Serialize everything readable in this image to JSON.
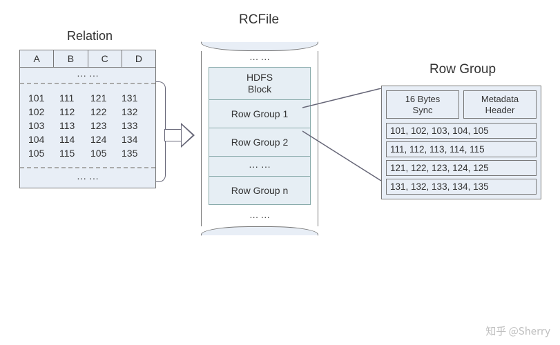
{
  "relation": {
    "title": "Relation",
    "headers": [
      "A",
      "B",
      "C",
      "D"
    ],
    "ellipsis": "···    ···",
    "rows": [
      [
        "101",
        "111",
        "121",
        "131"
      ],
      [
        "102",
        "112",
        "122",
        "132"
      ],
      [
        "103",
        "113",
        "123",
        "133"
      ],
      [
        "104",
        "114",
        "124",
        "134"
      ],
      [
        "105",
        "115",
        "105",
        "135"
      ]
    ],
    "footer": "···    ···"
  },
  "rcfile": {
    "title": "RCFile",
    "top_ellipsis": "···  ···",
    "hdfs_label": "HDFS\nBlock",
    "groups": [
      "Row Group 1",
      "Row Group 2",
      "···  ···",
      "Row Group n"
    ],
    "bottom_ellipsis": "···  ···"
  },
  "rowgroup": {
    "title": "Row Group",
    "sync_label": "16 Bytes\nSync",
    "meta_label": "Metadata\nHeader",
    "data_rows": [
      "101, 102, 103, 104, 105",
      "111, 112, 113, 114, 115",
      "121, 122, 123, 124, 125",
      "131, 132, 133, 134, 135"
    ]
  },
  "chart_data": {
    "type": "table",
    "title": "RCFile storage layout diagram",
    "relation_columns": [
      "A",
      "B",
      "C",
      "D"
    ],
    "relation_rows": [
      [
        101,
        111,
        121,
        131
      ],
      [
        102,
        112,
        122,
        132
      ],
      [
        103,
        113,
        123,
        133
      ],
      [
        104,
        114,
        124,
        134
      ],
      [
        105,
        115,
        105,
        135
      ]
    ],
    "rcfile_structure": [
      "HDFS Block",
      "Row Group 1",
      "Row Group 2",
      "...",
      "Row Group n"
    ],
    "row_group_header": [
      "16 Bytes Sync",
      "Metadata Header"
    ],
    "row_group_column_stripes": [
      [
        101,
        102,
        103,
        104,
        105
      ],
      [
        111,
        112,
        113,
        114,
        115
      ],
      [
        121,
        122,
        123,
        124,
        125
      ],
      [
        131,
        132,
        133,
        134,
        135
      ]
    ]
  },
  "watermark": "知乎 @Sherry"
}
